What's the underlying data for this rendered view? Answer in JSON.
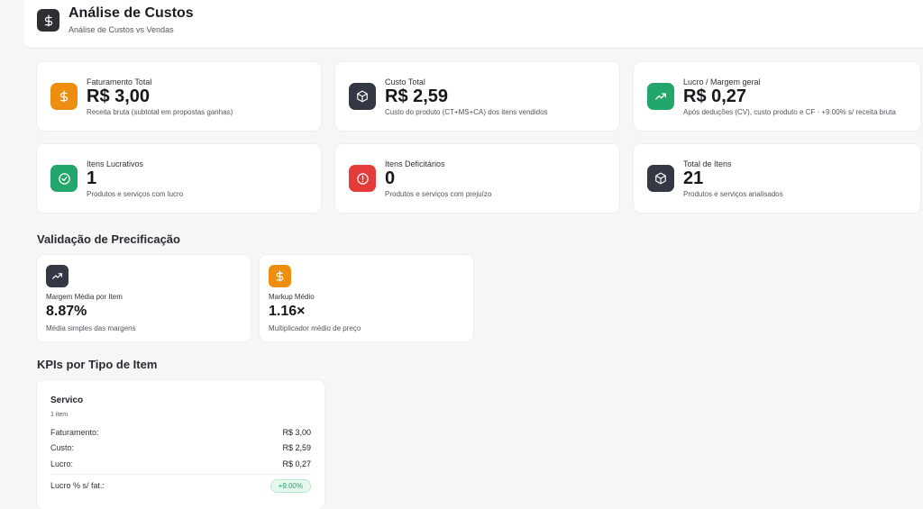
{
  "header": {
    "icon": "dollar-icon",
    "title": "Análise de Custos",
    "subtitle": "Análise de Custos vs Vendas"
  },
  "kpis": [
    {
      "label": "Faturamento Total",
      "value": "R$ 3,00",
      "desc": "Receita bruta (subtotal em propostas ganhas)",
      "icon": "dollar-icon",
      "color": "#ee8e10"
    },
    {
      "label": "Custo Total",
      "value": "R$ 2,59",
      "desc": "Custo do produto (CT+MS+CA) dos itens vendidos",
      "icon": "box-icon",
      "color": "#343844"
    },
    {
      "label": "Lucro / Margem geral",
      "value": "R$ 0,27",
      "desc": "Após deduções (CV), custo produto e CF · +9.00% s/ receita bruta",
      "icon": "trending-up-icon",
      "color": "#22a66a"
    },
    {
      "label": "Itens Lucrativos",
      "value": "1",
      "desc": "Produtos e serviços com lucro",
      "icon": "check-circle-icon",
      "color": "#22a66a"
    },
    {
      "label": "Itens Deficitários",
      "value": "0",
      "desc": "Produtos e serviços com prejuízo",
      "icon": "alert-circle-icon",
      "color": "#e43a3a"
    },
    {
      "label": "Total de Itens",
      "value": "21",
      "desc": "Produtos e serviços analisados",
      "icon": "box-icon",
      "color": "#343844"
    }
  ],
  "validation": {
    "title": "Validação de Precificação",
    "cards": [
      {
        "label": "Margem Média por Item",
        "value": "8.87%",
        "desc": "Média simples das margens",
        "icon": "trending-up-icon",
        "color": "#343844"
      },
      {
        "label": "Markup Médio",
        "value": "1.16×",
        "desc": "Multiplicador médio de preço",
        "icon": "dollar-icon",
        "color": "#ee8e10"
      }
    ]
  },
  "types": {
    "title": "KPIs por Tipo de Item",
    "card": {
      "name": "Servico",
      "count": "1 item",
      "rows": [
        {
          "label": "Faturamento:",
          "value": "R$ 3,00"
        },
        {
          "label": "Custo:",
          "value": "R$ 2,59"
        },
        {
          "label": "Lucro:",
          "value": "R$ 0,27"
        }
      ],
      "margin_label": "Lucro % s/ fat.:",
      "margin_value": "+9.00%"
    }
  }
}
